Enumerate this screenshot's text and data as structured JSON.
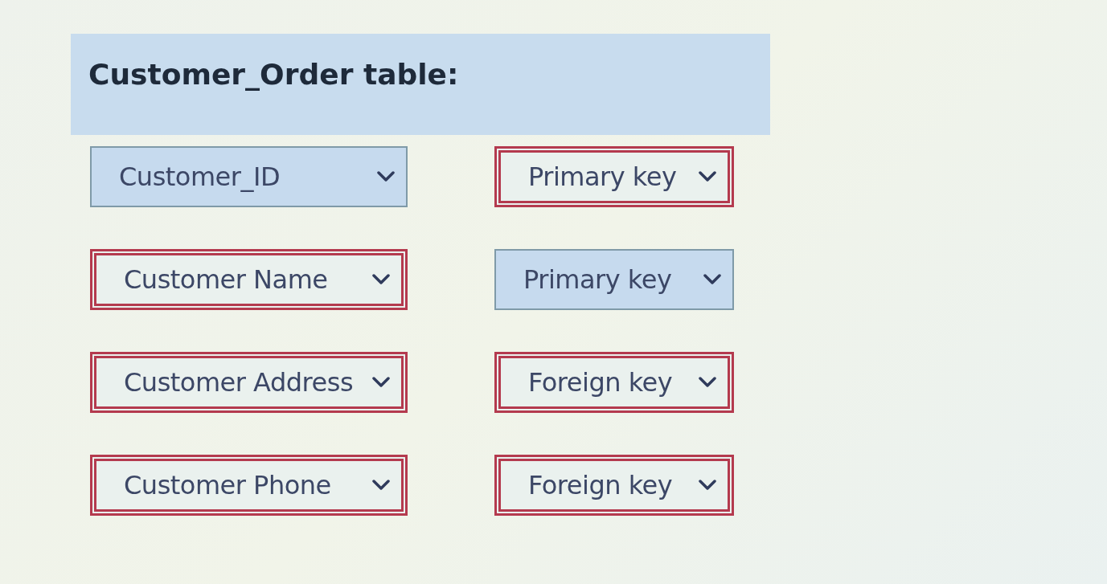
{
  "heading": "Customer_Order table:",
  "rows": [
    {
      "field": {
        "value": "Customer_ID",
        "marked_incorrect": false
      },
      "key_type": {
        "value": "Primary key",
        "marked_incorrect": true
      }
    },
    {
      "field": {
        "value": "Customer Name",
        "marked_incorrect": true
      },
      "key_type": {
        "value": "Primary key",
        "marked_incorrect": false
      }
    },
    {
      "field": {
        "value": "Customer Address",
        "marked_incorrect": true
      },
      "key_type": {
        "value": "Foreign key",
        "marked_incorrect": true
      }
    },
    {
      "field": {
        "value": "Customer Phone",
        "marked_incorrect": true
      },
      "key_type": {
        "value": "Foreign key",
        "marked_incorrect": true
      }
    }
  ]
}
